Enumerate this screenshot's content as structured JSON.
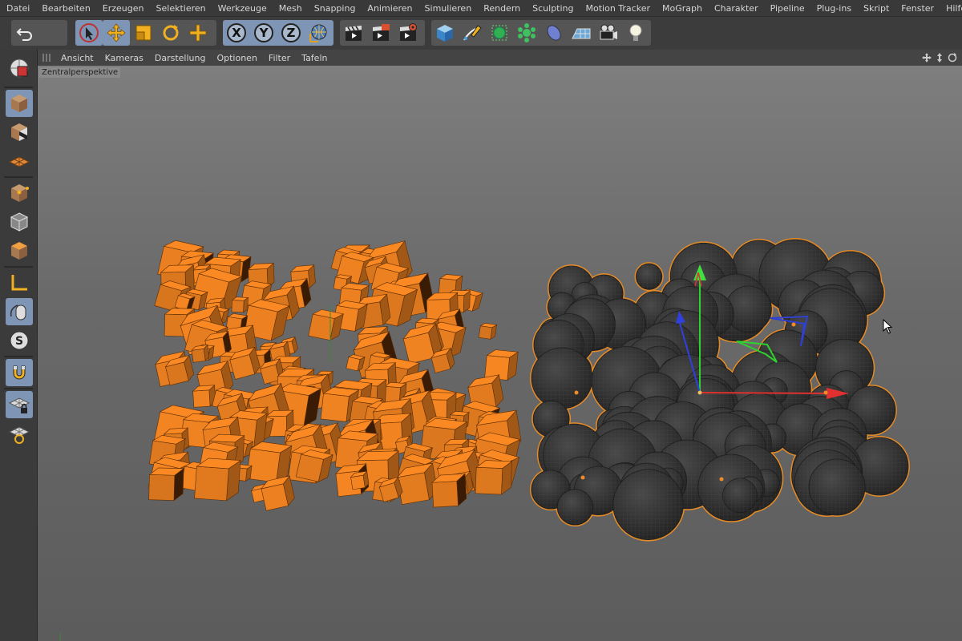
{
  "menubar": {
    "items": [
      "Datei",
      "Bearbeiten",
      "Erzeugen",
      "Selektieren",
      "Werkzeuge",
      "Mesh",
      "Snapping",
      "Animieren",
      "Simulieren",
      "Rendern",
      "Sculpting",
      "Motion Tracker",
      "MoGraph",
      "Charakter",
      "Pipeline",
      "Plug-ins",
      "Skript",
      "Fenster",
      "Hilfe"
    ]
  },
  "toolbar": {
    "undo_icon": "undo-icon",
    "axis_x": "X",
    "axis_y": "Y",
    "axis_z": "Z",
    "active_tool": "live-selection",
    "accent": "#7e95b5"
  },
  "viewport_menu": {
    "items": [
      "Ansicht",
      "Kameras",
      "Darstellung",
      "Optionen",
      "Filter",
      "Tafeln"
    ]
  },
  "viewport": {
    "projection_label": "Zentralperspektive",
    "cube_color": "#e07a1f",
    "sphere_color": "#2f2f2f",
    "selection_outline": "#e08a2a"
  },
  "left_palette": {
    "active_modes": [
      "model-mode",
      "axis-mode",
      "snap-toggle",
      "workplane-lock"
    ]
  }
}
